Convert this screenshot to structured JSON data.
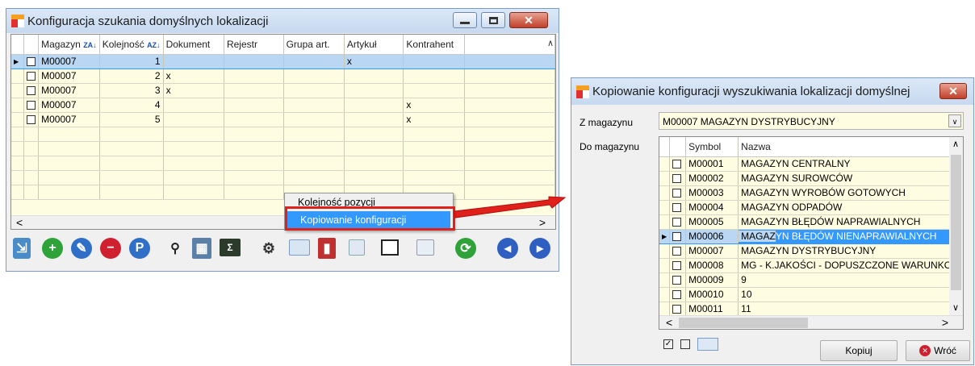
{
  "win1": {
    "title": "Konfiguracja szukania domyślnych lokalizacji",
    "columns": [
      "Magazyn",
      "Kolejność",
      "Dokument",
      "Rejestr",
      "Grupa art.",
      "Artykuł",
      "Kontrahent"
    ],
    "rows": [
      {
        "magazyn": "M00007",
        "kolejnosc": "1",
        "dokument": "",
        "rejestr": "",
        "grupa": "",
        "artykul": "x",
        "kontrahent": ""
      },
      {
        "magazyn": "M00007",
        "kolejnosc": "2",
        "dokument": "x",
        "rejestr": "",
        "grupa": "",
        "artykul": "",
        "kontrahent": ""
      },
      {
        "magazyn": "M00007",
        "kolejnosc": "3",
        "dokument": "x",
        "rejestr": "",
        "grupa": "",
        "artykul": "",
        "kontrahent": ""
      },
      {
        "magazyn": "M00007",
        "kolejnosc": "4",
        "dokument": "",
        "rejestr": "",
        "grupa": "",
        "artykul": "",
        "kontrahent": "x"
      },
      {
        "magazyn": "M00007",
        "kolejnosc": "5",
        "dokument": "",
        "rejestr": "",
        "grupa": "",
        "artykul": "",
        "kontrahent": "x"
      }
    ],
    "context_menu": [
      "Kolejność pozycji",
      "Kopiowanie konfiguracji"
    ]
  },
  "win2": {
    "title": "Kopiowanie konfiguracji wyszukiwania lokalizacji domyślnej",
    "from_label": "Z magazynu",
    "from_value": "M00007 MAGAZYN DYSTRYBUCYJNY",
    "to_label": "Do magazynu",
    "col_symbol": "Symbol",
    "col_nazwa": "Nazwa",
    "rows": [
      {
        "symbol": "M00001",
        "nazwa": "MAGAZYN CENTRALNY"
      },
      {
        "symbol": "M00002",
        "nazwa": "MAGAZYN SUROWCÓW"
      },
      {
        "symbol": "M00003",
        "nazwa": "MAGAZYN WYROBÓW GOTOWYCH"
      },
      {
        "symbol": "M00004",
        "nazwa": "MAGAZYN ODPADÓW"
      },
      {
        "symbol": "M00005",
        "nazwa": "MAGAZYN BŁĘDÓW NAPRAWIALNYCH"
      },
      {
        "symbol": "M00006",
        "nazwa_a": "MAGAZ",
        "nazwa_b": "YN BŁĘDÓW NIENAPRAWIALNYCH"
      },
      {
        "symbol": "M00007",
        "nazwa": "MAGAZYN DYSTRYBUCYJNY"
      },
      {
        "symbol": "M00008",
        "nazwa": "MG - K.JAKOŚCI - DOPUSZCZONE WARUNKO"
      },
      {
        "symbol": "M00009",
        "nazwa": "9"
      },
      {
        "symbol": "M00010",
        "nazwa": "10"
      },
      {
        "symbol": "M00011",
        "nazwa": "11"
      }
    ],
    "copy_button": "Kopiuj",
    "back_button": "Wróć"
  },
  "colors": {
    "highlight": "#3399ff",
    "arrow": "#e0201a",
    "grid_bg": "#fffde1"
  }
}
